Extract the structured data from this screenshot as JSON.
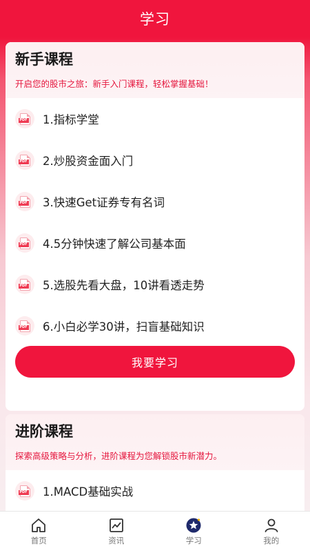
{
  "header": {
    "title": "学习"
  },
  "beginner": {
    "title": "新手课程",
    "subtitle": "开启您的股市之旅：新手入门课程，轻松掌握基础！",
    "items": [
      {
        "label": "1.指标学堂",
        "icon": "pdf-icon"
      },
      {
        "label": "2.炒股资金面入门",
        "icon": "pdf-icon"
      },
      {
        "label": "3.快速Get证券专有名词",
        "icon": "pdf-icon"
      },
      {
        "label": "4.5分钟快速了解公司基本面",
        "icon": "pdf-icon"
      },
      {
        "label": "5.选股先看大盘，10讲看透走势",
        "icon": "pdf-icon"
      },
      {
        "label": "6.小白必学30讲，扫盲基础知识",
        "icon": "pdf-icon"
      }
    ],
    "button": "我要学习",
    "pdf_tag": "PDF"
  },
  "advanced": {
    "title": "进阶课程",
    "subtitle": "探索高级策略与分析，进阶课程为您解锁股市新潜力。",
    "items": [
      {
        "label": "1.MACD基础实战",
        "icon": "pdf-icon"
      }
    ]
  },
  "tabbar": {
    "tabs": [
      {
        "label": "首页",
        "icon": "home-icon",
        "active": false
      },
      {
        "label": "资讯",
        "icon": "chart-icon",
        "active": false
      },
      {
        "label": "学习",
        "icon": "star-badge-icon",
        "active": true
      },
      {
        "label": "我的",
        "icon": "user-icon",
        "active": false
      }
    ]
  },
  "colors": {
    "brand": "#f0153d",
    "subtitle": "#e5173e",
    "tab_active": "#1f2a6b"
  }
}
